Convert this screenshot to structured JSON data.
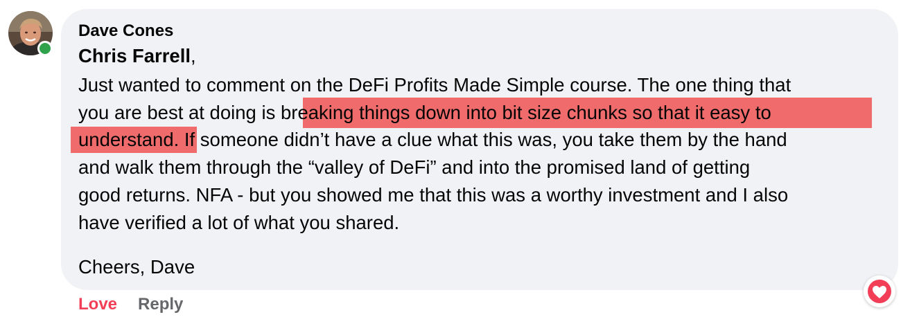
{
  "comment": {
    "author": "Dave Cones",
    "online": true,
    "mention": "Chris Farrell",
    "mention_suffix": ",",
    "lines": [
      "Just wanted to comment on the DeFi Profits Made Simple course. The one thing that",
      "you are best at doing is breaking things down into bit size chunks so that it easy to",
      "understand. If someone didn’t have a clue what this was, you take them by the hand",
      "and walk them through the “valley of DeFi” and into the promised land of getting",
      "good returns. NFA - but you showed me that this was a worthy investment and I also",
      "have verified a lot of what you shared."
    ],
    "signoff": "Cheers, Dave",
    "highlighted_phrase": "breaking things down into bit size chunks so that it easy to understand.",
    "highlight_color": "#f06c6c"
  },
  "actions": {
    "love_label": "Love",
    "reply_label": "Reply",
    "love_color": "#f33e58"
  },
  "reaction": {
    "type": "heart-icon",
    "color": "#f33e58"
  },
  "colors": {
    "bubble": "#f0f2f5",
    "presence": "#31a24c"
  }
}
